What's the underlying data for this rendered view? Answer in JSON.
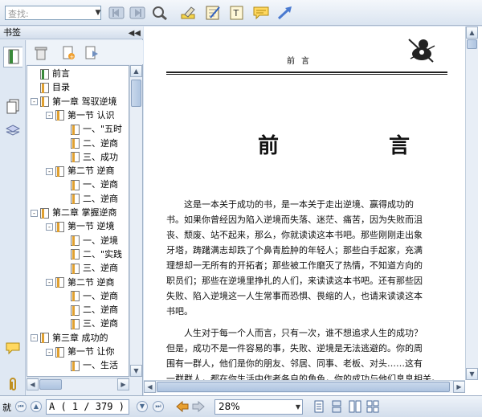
{
  "toolbar": {
    "search_placeholder": "查找:",
    "buttons": [
      "prev-result-icon",
      "next-result-icon",
      "advanced-search-icon",
      "highlighter-icon",
      "notepad-icon",
      "text-tool-icon",
      "comment-icon",
      "arrow-tool-icon"
    ]
  },
  "bookmarks_panel": {
    "title": "书签",
    "tree": [
      {
        "label": "前言",
        "level": 0,
        "toggle": "",
        "icon": "green"
      },
      {
        "label": "目录",
        "level": 0,
        "toggle": "",
        "icon": "yellow"
      },
      {
        "label": "第一章  驾驭逆境",
        "level": 0,
        "toggle": "-",
        "icon": "yellow"
      },
      {
        "label": "第一节  认识",
        "level": 1,
        "toggle": "-",
        "icon": "yellow"
      },
      {
        "label": "一、\"五时",
        "level": 2,
        "toggle": "",
        "icon": "yellow"
      },
      {
        "label": "二、逆商",
        "level": 2,
        "toggle": "",
        "icon": "yellow"
      },
      {
        "label": "三、成功",
        "level": 2,
        "toggle": "",
        "icon": "yellow"
      },
      {
        "label": "第二节  逆商",
        "level": 1,
        "toggle": "-",
        "icon": "yellow"
      },
      {
        "label": "一、逆商",
        "level": 2,
        "toggle": "",
        "icon": "yellow"
      },
      {
        "label": "二、逆商",
        "level": 2,
        "toggle": "",
        "icon": "yellow"
      },
      {
        "label": "第二章  掌握逆商",
        "level": 0,
        "toggle": "-",
        "icon": "yellow"
      },
      {
        "label": "第一节  逆境",
        "level": 1,
        "toggle": "-",
        "icon": "yellow"
      },
      {
        "label": "一、逆境",
        "level": 2,
        "toggle": "",
        "icon": "yellow"
      },
      {
        "label": "二、\"实践",
        "level": 2,
        "toggle": "",
        "icon": "yellow"
      },
      {
        "label": "三、逆商",
        "level": 2,
        "toggle": "",
        "icon": "yellow"
      },
      {
        "label": "第二节  逆商",
        "level": 1,
        "toggle": "-",
        "icon": "yellow"
      },
      {
        "label": "一、逆商",
        "level": 2,
        "toggle": "",
        "icon": "yellow"
      },
      {
        "label": "二、逆商",
        "level": 2,
        "toggle": "",
        "icon": "yellow"
      },
      {
        "label": "三、逆商",
        "level": 2,
        "toggle": "",
        "icon": "yellow"
      },
      {
        "label": "第三章  成功的",
        "level": 0,
        "toggle": "-",
        "icon": "yellow"
      },
      {
        "label": "第一节  让你",
        "level": 1,
        "toggle": "-",
        "icon": "yellow"
      },
      {
        "label": "一、生活",
        "level": 2,
        "toggle": "",
        "icon": "yellow"
      }
    ]
  },
  "document": {
    "running_head": "前言",
    "title": "前    言",
    "paragraph1": [
      "这是一本关于成功的书，是一本关于走出逆境、赢得成功的",
      "书。如果你曾经因为陷入逆境而失落、迷茫、痛苦，因为失败而沮",
      "丧、颓废、站不起来，那么，你就读读这本书吧。那些刚刚走出象",
      "牙塔，踌躇满志却跌了个鼻青脸肿的年轻人；那些白手起家，充满",
      "理想却一无所有的开拓者；那些被工作磨灭了热情，不知道方向的",
      "职员们；那些在逆境里挣扎的人们，来读读这本书吧。还有那些因",
      "失败、陷入逆境这一人生常事而恐惧、畏缩的人，也请来读读这本",
      "书吧。"
    ],
    "paragraph2": [
      "人生对于每一个人而言，只有一次，谁不想追求人生的成功？",
      "但是，成功不是一件容易的事，失败、逆境是无法逃避的。你的周",
      "围有一群人，他们是你的朋友、邻居、同事、老板、对头……这有",
      "一群群人，都在你生活中作者各自的角色，你的成功与他们息息相关。"
    ]
  },
  "statusbar": {
    "left_label": "就",
    "page_display": "A  ( 1 / 379 )",
    "zoom": "28%"
  }
}
